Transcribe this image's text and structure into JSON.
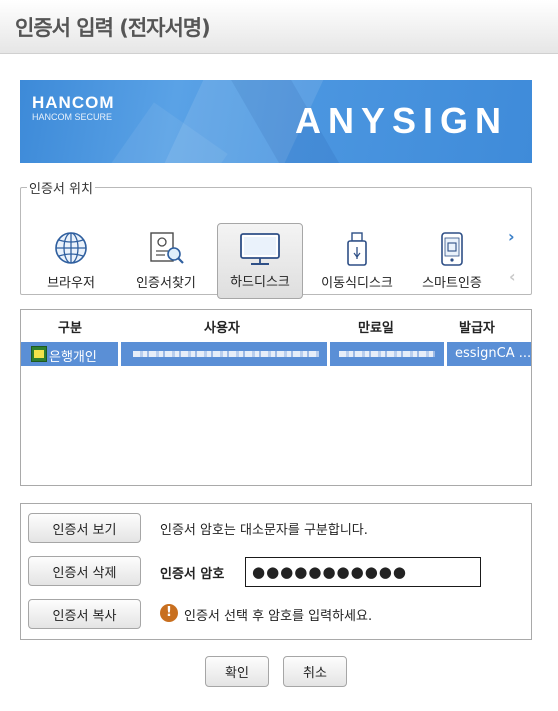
{
  "window": {
    "title": "인증서 입력 (전자서명)"
  },
  "banner": {
    "logo": "HANCOM",
    "logo_sub": "HANCOM SECURE",
    "brand": "ANYSIGN"
  },
  "location": {
    "legend": "인증서 위치",
    "items": [
      {
        "label": "브라우저",
        "icon": "globe-icon"
      },
      {
        "label": "인증서찾기",
        "icon": "certificate-search-icon"
      },
      {
        "label": "하드디스크",
        "icon": "monitor-icon",
        "selected": true
      },
      {
        "label": "이동식디스크",
        "icon": "usb-drive-icon"
      },
      {
        "label": "스마트인증",
        "icon": "smartphone-icon"
      }
    ],
    "next": "›",
    "prev": "‹"
  },
  "cert_table": {
    "columns": [
      "구분",
      "사용자",
      "만료일",
      "발급자"
    ],
    "rows": [
      {
        "type": "은행개인",
        "issuer": "essignCA ..."
      }
    ]
  },
  "panel": {
    "view_button": "인증서 보기",
    "delete_button": "인증서 삭제",
    "copy_button": "인증서 복사",
    "case_notice": "인증서 암호는 대소문자를 구분합니다.",
    "password_label": "인증서 암호",
    "password_value": "●●●●●●●●●●●",
    "warning_icon": "!",
    "warning_text": "인증서 선택 후 암호를 입력하세요."
  },
  "footer": {
    "ok_button": "확인",
    "cancel_button": "취소"
  },
  "colors": {
    "banner": "#4b96e0",
    "selection": "#5a8fd6",
    "warning": "#c86f1f"
  }
}
